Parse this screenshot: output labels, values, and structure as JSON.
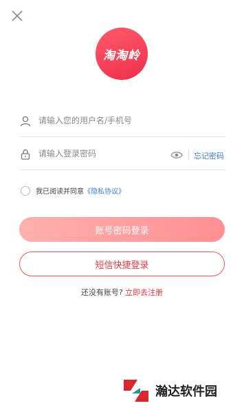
{
  "logo": {
    "text": "淘淘岭",
    "color": "#ef2f4a"
  },
  "login": {
    "username_placeholder": "请输入您的用户名/手机号",
    "password_placeholder": "请输入登录密码",
    "forgot_label": "忘记密码"
  },
  "agreement": {
    "prefix": "我已阅读并同意",
    "link": "《隐私协议》"
  },
  "buttons": {
    "password_login": "账号密码登录",
    "sms_login": "短信快捷登录"
  },
  "register": {
    "prompt": "还没有账号?",
    "link": "立即去注册"
  },
  "watermark": {
    "text": "瀚达软件园"
  },
  "colors": {
    "accent": "#e6333c",
    "link": "#3d7bd6"
  }
}
